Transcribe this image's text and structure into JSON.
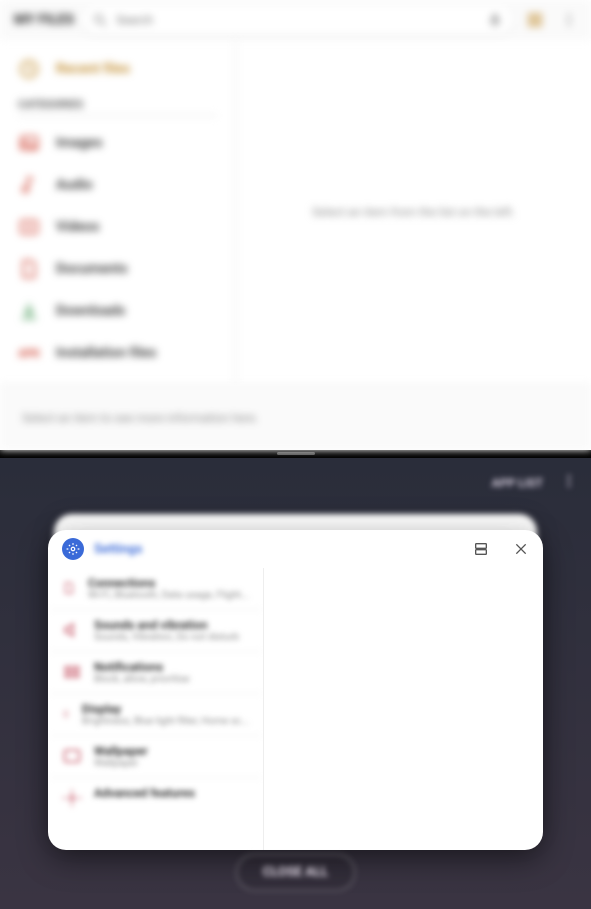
{
  "myfiles": {
    "title": "MY FILES",
    "search_placeholder": "Search",
    "sidebar": {
      "recent_label": "Recent files",
      "categories_label": "CATEGORIES",
      "items": [
        {
          "label": "Images"
        },
        {
          "label": "Audio"
        },
        {
          "label": "Videos"
        },
        {
          "label": "Documents"
        },
        {
          "label": "Downloads"
        },
        {
          "label": "Installation files"
        }
      ]
    },
    "main_message": "Select an item from the list on the left.",
    "info_message": "Select an item to see more information here."
  },
  "recents": {
    "app_list_label": "APP LIST",
    "close_all_label": "CLOSE ALL",
    "settings_card": {
      "app_name": "Settings",
      "rows": [
        {
          "title": "Connections",
          "sub": "Wi-Fi, Bluetooth, Data usage, Flight..."
        },
        {
          "title": "Sounds and vibration",
          "sub": "Sounds, Vibration, Do not disturb"
        },
        {
          "title": "Notifications",
          "sub": "Block, allow, prioritise"
        },
        {
          "title": "Display",
          "sub": "Brightness, Blue light filter, Home sc..."
        },
        {
          "title": "Wallpaper",
          "sub": "Wallpaper"
        },
        {
          "title": "Advanced features",
          "sub": ""
        }
      ]
    }
  }
}
